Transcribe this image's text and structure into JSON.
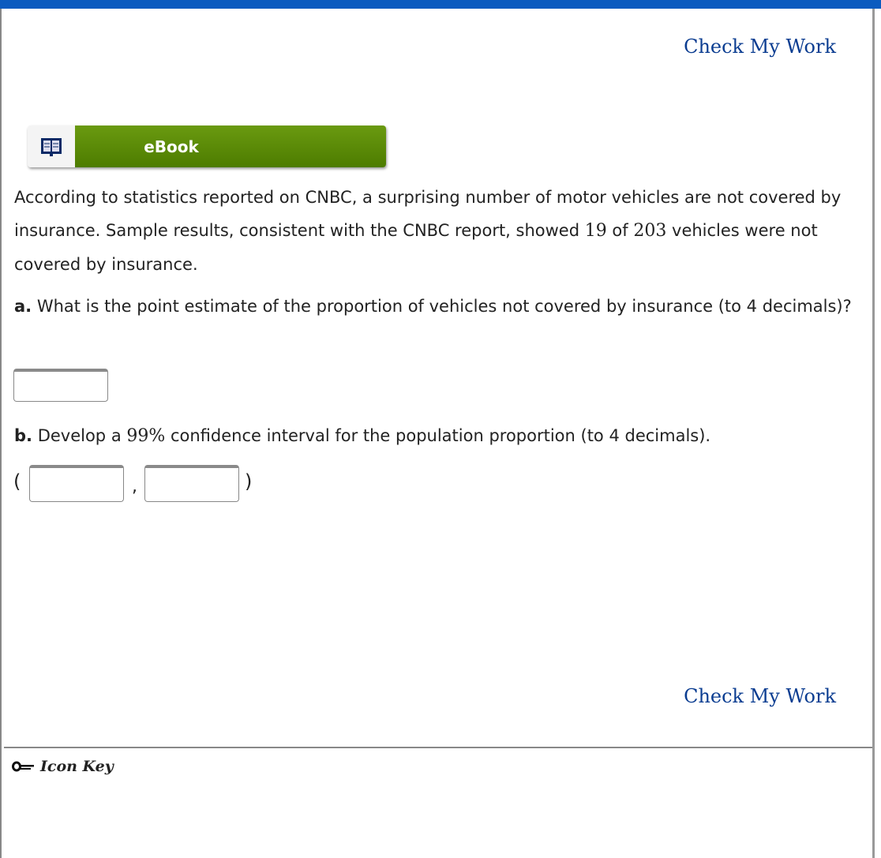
{
  "header": {
    "check_my_work": "Check My Work"
  },
  "ebook": {
    "label": "eBook",
    "icon": "book-icon"
  },
  "problem": {
    "intro_1": "According to statistics reported on CNBC, a surprising number of motor vehicles are not covered by insurance. Sample results, consistent with the CNBC report, showed ",
    "count": "19",
    "intro_2": " of ",
    "total": "203",
    "intro_3": " vehicles were not covered by insurance."
  },
  "part_a": {
    "label": "a.",
    "text": " What is the point estimate of the proportion of vehicles not covered by insurance (to 4 decimals)?",
    "value": ""
  },
  "part_b": {
    "label": "b.",
    "text_1": " Develop a ",
    "confidence": "99%",
    "text_2": " confidence interval for the population proportion (to 4 decimals).",
    "open": "(",
    "comma": ",",
    "close": ")",
    "lower": "",
    "upper": ""
  },
  "footer": {
    "check_my_work": "Check My Work",
    "icon_key": "Icon Key",
    "icon": "key-icon"
  },
  "colors": {
    "topbar": "#0b5bbf",
    "ebook_green": "#5a8a00",
    "link": "#0b3d91"
  }
}
